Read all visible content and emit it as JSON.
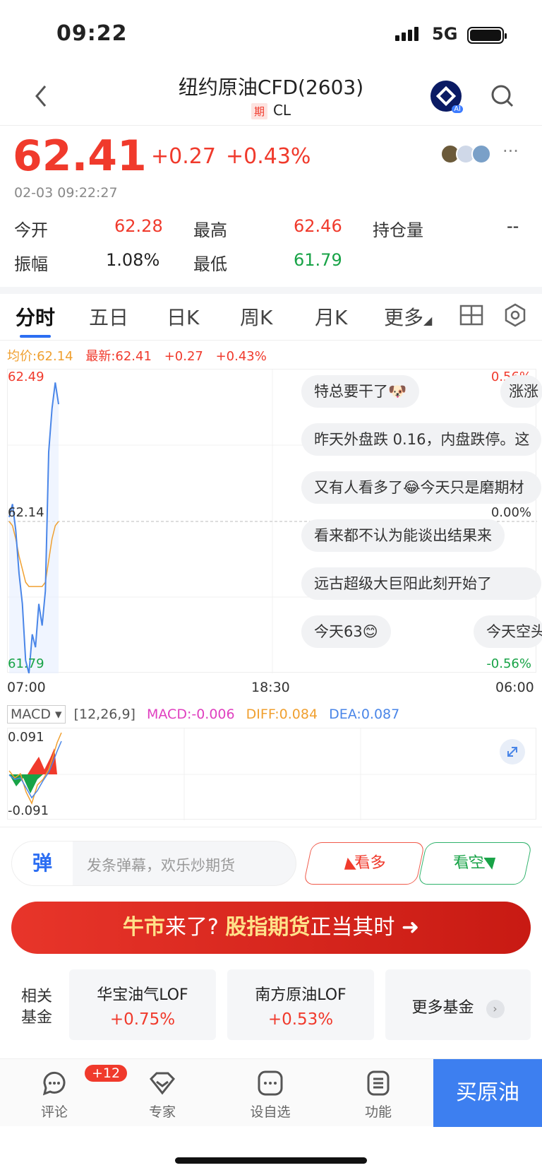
{
  "status_bar": {
    "time": "09:22",
    "network": "5G"
  },
  "nav": {
    "title": "纽约原油CFD(2603)",
    "qi_tag": "期",
    "code": "CL",
    "ai_badge": "AI"
  },
  "quote": {
    "price": "62.41",
    "change": "+0.27",
    "change_pct": "+0.43%",
    "timestamp": "02-03 09:22:27",
    "more": "···",
    "stats": {
      "open_label": "今开",
      "open": "62.28",
      "high_label": "最高",
      "high": "62.46",
      "oi_label": "持仓量",
      "oi": "--",
      "amp_label": "振幅",
      "amp": "1.08%",
      "low_label": "最低",
      "low": "61.79"
    }
  },
  "tabs": [
    "分时",
    "五日",
    "日K",
    "周K",
    "月K",
    "更多"
  ],
  "chart_info": {
    "avg": "均价:62.14",
    "latest": "最新:62.41",
    "chg": "+0.27",
    "pct": "+0.43%"
  },
  "chart_axes": {
    "y_top": "62.49",
    "y_mid": "62.14",
    "y_bottom": "61.79",
    "r_top": "0.56%",
    "r_mid": "0.00%",
    "r_bottom": "-0.56%",
    "x_start": "07:00",
    "x_mid": "18:30",
    "x_end": "06:00"
  },
  "danmaku": [
    "特总要干了🐶",
    "涨涨",
    "昨天外盘跌 0.16，内盘跌停。这",
    "又有人看多了😂今天只是磨期材",
    "看来都不认为能谈出结果来",
    "远古超级大巨阳此刻开始了",
    "今天63😊",
    "今天空头"
  ],
  "macd": {
    "select": "MACD",
    "params": "[12,26,9]",
    "macd": "MACD:-0.006",
    "diff": "DIFF:0.084",
    "dea": "DEA:0.087",
    "y_top": "0.091",
    "y_bottom": "-0.091"
  },
  "chart_data": {
    "type": "line",
    "title": "",
    "series": [
      {
        "name": "",
        "values": [
          62.15,
          62.18,
          62.12,
          62.02,
          61.95,
          61.82,
          61.79,
          61.88,
          61.85,
          61.95,
          61.9,
          61.98,
          62.3,
          62.4,
          62.46,
          62.41
        ]
      },
      {
        "name": "均价",
        "values": [
          62.14,
          62.13,
          62.1,
          62.06,
          62.03,
          62.0,
          61.99,
          61.99,
          61.99,
          61.99,
          61.99,
          62.0,
          62.05,
          62.1,
          62.13,
          62.14
        ]
      }
    ],
    "ylim": [
      61.79,
      62.49
    ],
    "colors": {
      "price": "#4a86e8",
      "avg": "#f0a030"
    }
  },
  "colors": {
    "up": "#f03a2c",
    "down": "#18a347",
    "accent": "#2c6ef2",
    "macd": "#e040c0",
    "diff": "#f0a030",
    "dea": "#4a86e8"
  },
  "comment_bar": {
    "icon": "弹",
    "placeholder": "发条弹幕，欢乐炒期货",
    "bull": "看多",
    "bear": "看空"
  },
  "banner": {
    "p1": "牛市",
    "p2": "来了? ",
    "p3": "股指期货",
    "p4": "正当其时 ➜"
  },
  "funds": {
    "label1": "相关",
    "label2": "基金",
    "items": [
      {
        "name": "华宝油气LOF",
        "pct": "+0.75%"
      },
      {
        "name": "南方原油LOF",
        "pct": "+0.53%"
      }
    ],
    "more": "更多基金"
  },
  "tabbar": {
    "comment": "评论",
    "badge": "+12",
    "expert": "专家",
    "watch": "设自选",
    "func": "功能",
    "buy": "买原油"
  }
}
